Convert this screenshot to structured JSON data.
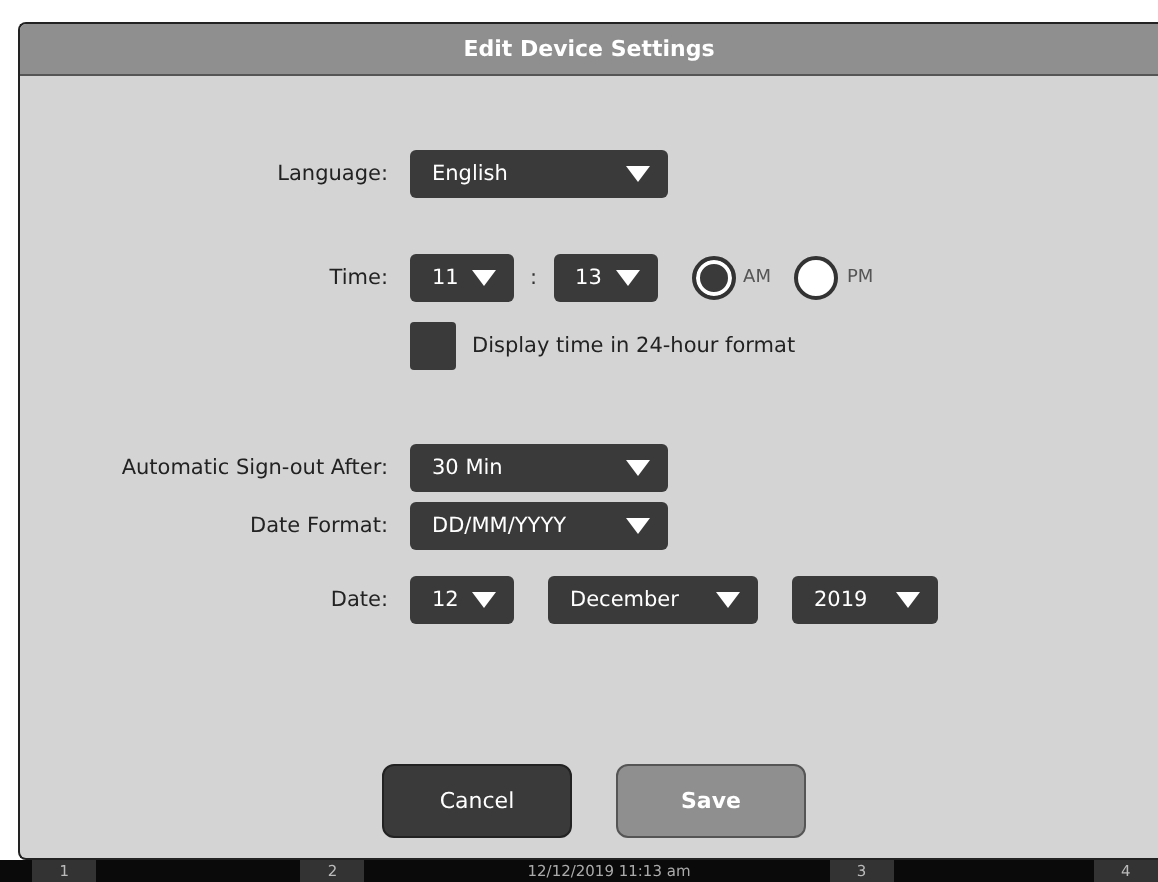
{
  "dialog": {
    "title": "Edit Device Settings"
  },
  "rows": [
    {
      "kind": "dropdowns",
      "label": "Language:",
      "selects": [
        {
          "value": "English"
        }
      ]
    },
    {
      "kind": "time",
      "label": "Time:",
      "selects": [
        {
          "value": "11"
        },
        {
          "value": "13"
        }
      ],
      "separator": ":",
      "radios": [
        {
          "label": "AM",
          "selected": true
        },
        {
          "label": "PM",
          "selected": false
        }
      ]
    },
    {
      "kind": "checkbox",
      "label": "Display time in 24-hour format",
      "checked": false
    },
    {
      "kind": "dropdowns",
      "label": "Automatic Sign-out After:",
      "selects": [
        {
          "value": "30 Min"
        }
      ]
    },
    {
      "kind": "dropdowns",
      "label": "Date Format:",
      "selects": [
        {
          "value": "DD/MM/YYYY"
        }
      ]
    },
    {
      "kind": "dropdowns",
      "label": "Date:",
      "selects": [
        {
          "value": "12"
        },
        {
          "value": "December"
        },
        {
          "value": "2019"
        }
      ]
    }
  ],
  "buttons": [
    {
      "label": "Cancel",
      "disabled": false
    },
    {
      "label": "Save",
      "disabled": true
    }
  ],
  "taskbar": {
    "tabs": [
      "1",
      "2",
      "3",
      "4"
    ],
    "clock": "12/12/2019   11:13 am"
  }
}
